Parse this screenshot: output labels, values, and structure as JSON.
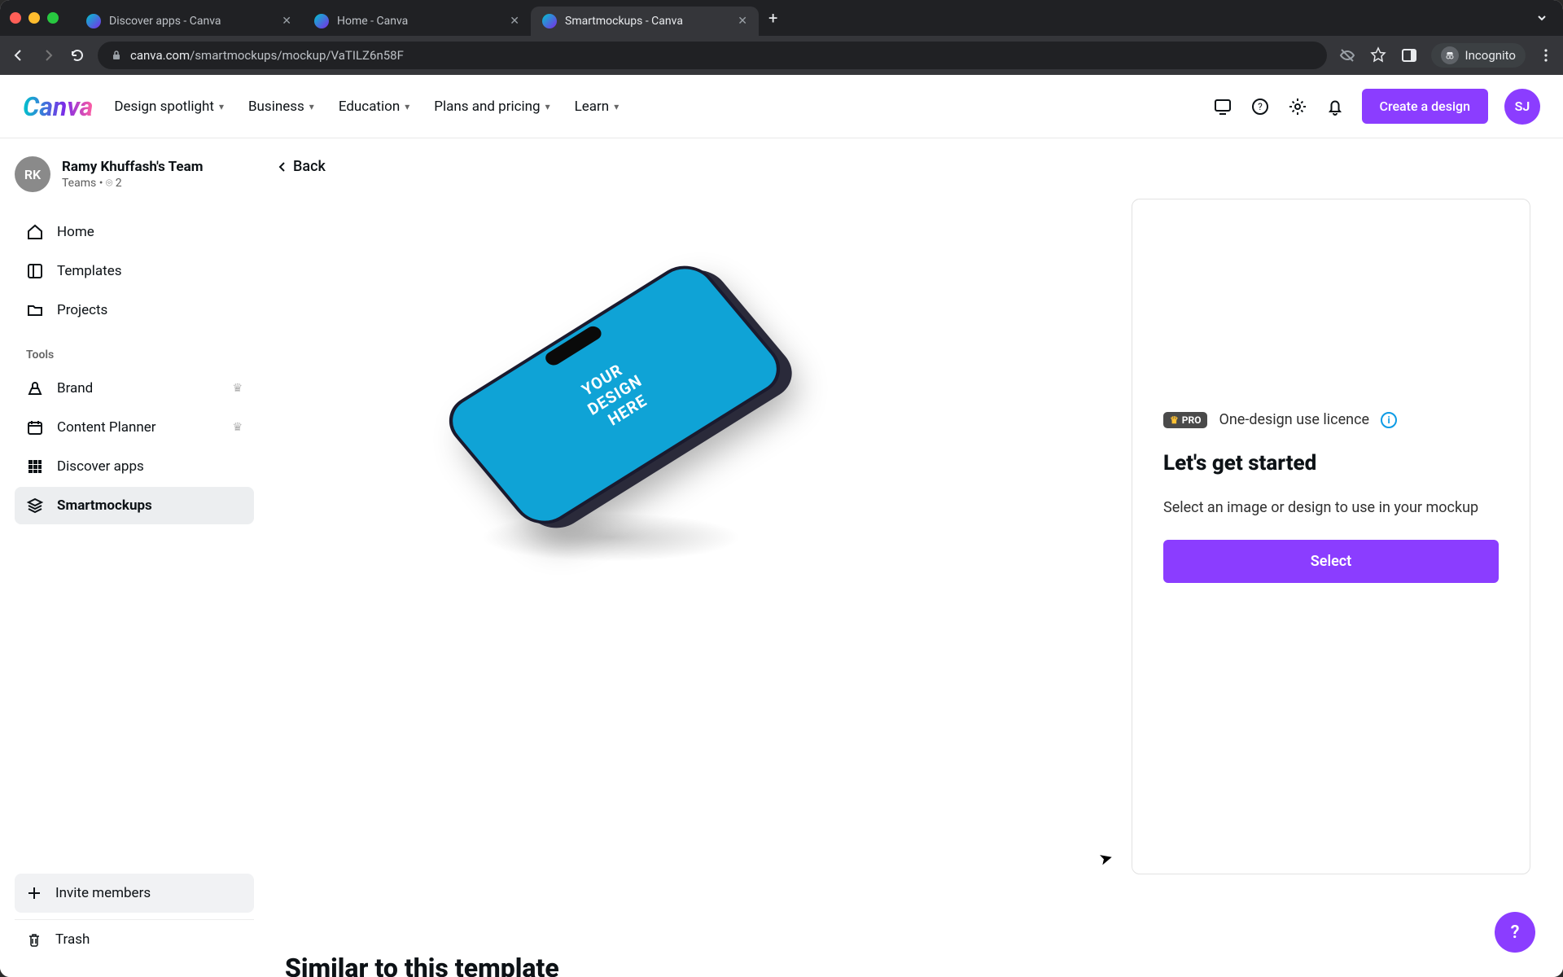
{
  "browser": {
    "tabs": [
      {
        "title": "Discover apps - Canva",
        "active": false
      },
      {
        "title": "Home - Canva",
        "active": false
      },
      {
        "title": "Smartmockups - Canva",
        "active": true
      }
    ],
    "url_domain": "canva.com",
    "url_path": "/smartmockups/mockup/VaTILZ6n58F",
    "incognito_label": "Incognito"
  },
  "topnav": {
    "logo": "Canva",
    "items": [
      "Design spotlight",
      "Business",
      "Education",
      "Plans and pricing",
      "Learn"
    ],
    "create_label": "Create a design",
    "avatar": "SJ"
  },
  "sidebar": {
    "team_avatar": "RK",
    "team_name": "Ramy Khuffash's Team",
    "team_sub": "Teams  •  ⌾ 2",
    "items_main": [
      {
        "icon": "home",
        "label": "Home"
      },
      {
        "icon": "templates",
        "label": "Templates"
      },
      {
        "icon": "folder",
        "label": "Projects"
      }
    ],
    "tools_heading": "Tools",
    "items_tools": [
      {
        "icon": "brand",
        "label": "Brand",
        "crown": true
      },
      {
        "icon": "calendar",
        "label": "Content Planner",
        "crown": true
      },
      {
        "icon": "grid",
        "label": "Discover apps",
        "crown": false
      },
      {
        "icon": "stack",
        "label": "Smartmockups",
        "crown": false,
        "active": true
      }
    ],
    "invite_label": "Invite members",
    "trash_label": "Trash"
  },
  "main": {
    "back_label": "Back",
    "mockup_text_l1": "YOUR",
    "mockup_text_l2": "DESIGN",
    "mockup_text_l3": "HERE",
    "similar_heading": "Similar to this template"
  },
  "panel": {
    "pro_badge": "PRO",
    "licence": "One-design use licence",
    "heading": "Let's get started",
    "body": "Select an image or design to use in your mockup",
    "select_label": "Select"
  },
  "fab": "?"
}
